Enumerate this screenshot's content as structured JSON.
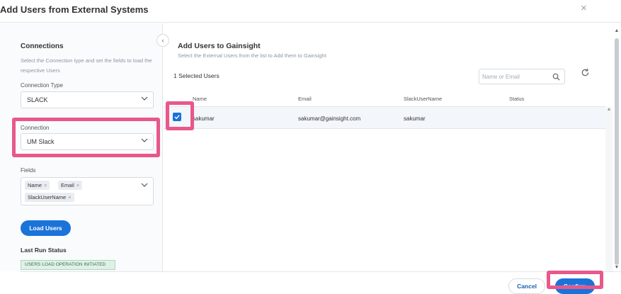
{
  "modal": {
    "title": "Add Users from External Systems",
    "close_glyph": "×"
  },
  "left": {
    "title": "Connections",
    "description": "Select the Connection type and set the fields to load the respective Users",
    "connection_type_label": "Connection Type",
    "connection_type_value": "SLACK",
    "connection_label": "Connection",
    "connection_value": "UM Slack",
    "fields_label": "Fields",
    "fields": [
      "Name",
      "Email",
      "SlackUserName"
    ],
    "load_button": "Load Users",
    "last_run_title": "Last Run Status",
    "last_run_status": "USERS LOAD OPERATION INITIATED",
    "collapse_glyph": "‹"
  },
  "right": {
    "title": "Add Users to Gainsight",
    "description": "Select the External Users from the list to Add them to Gainsight",
    "selected_count": "1 Selected Users",
    "search_placeholder": "Name or Email",
    "columns": [
      "Name",
      "Email",
      "SlackUserName",
      "Status"
    ],
    "rows": [
      {
        "name": "sakumar",
        "email": "sakumar@gainsight.com",
        "slack_user_name": "sakumar",
        "status": "",
        "checked": true
      }
    ]
  },
  "footer": {
    "cancel": "Cancel",
    "confirm": "Confirm"
  },
  "colors": {
    "accent": "#1a73d9",
    "highlight": "#e8588a",
    "status_bg": "#dff1e6"
  },
  "icons": [
    "close-icon",
    "chevron-down-icon",
    "search-icon",
    "refresh-icon",
    "check-icon",
    "chevron-left-icon"
  ]
}
